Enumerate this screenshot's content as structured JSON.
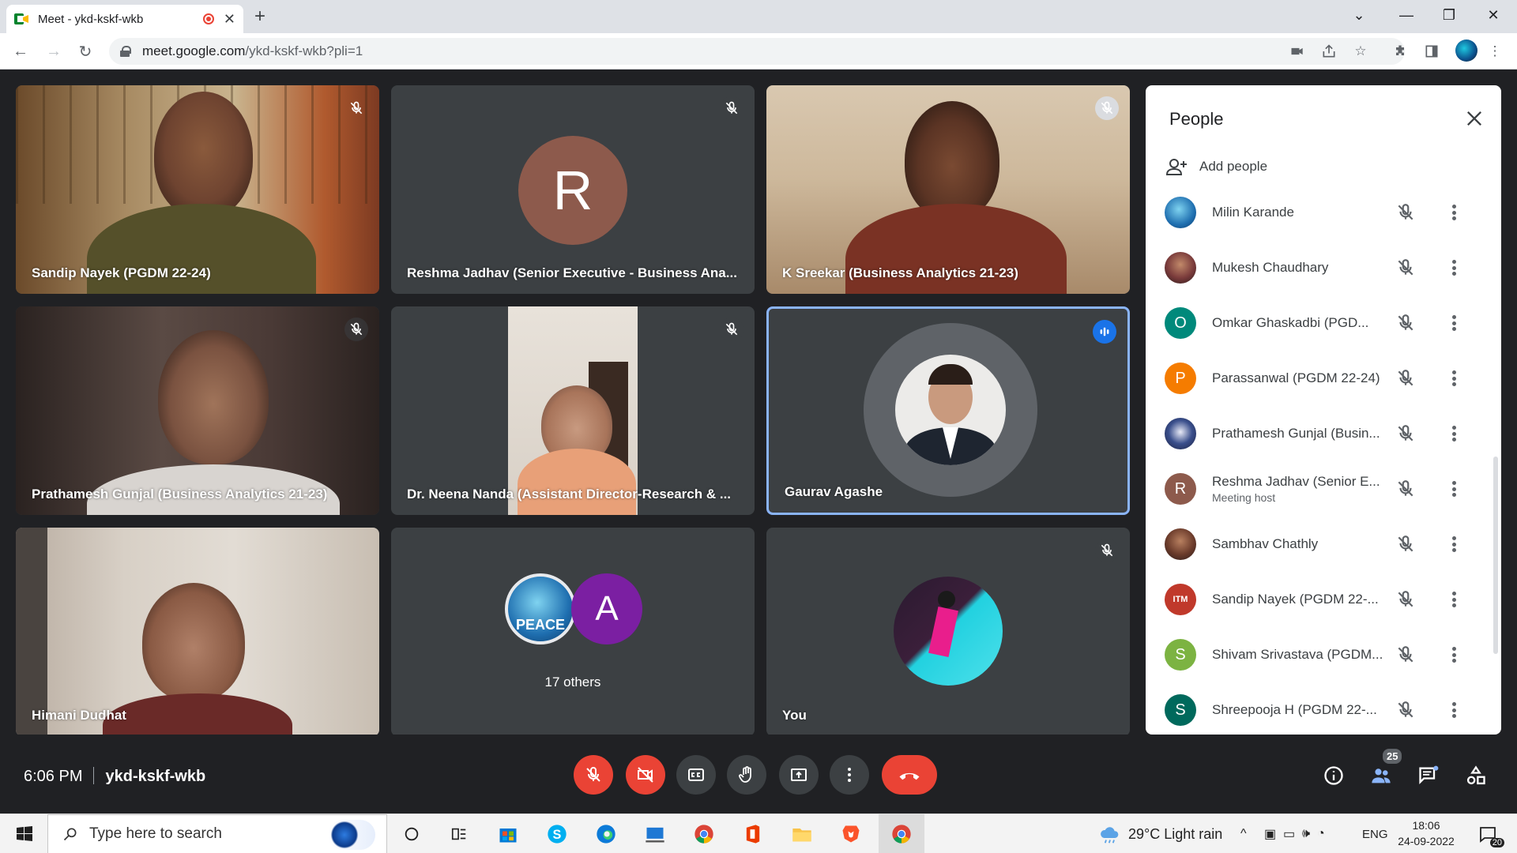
{
  "browser": {
    "tab_title": "Meet - ykd-kskf-wkb",
    "url_host": "meet.google.com",
    "url_path": "/ykd-kskf-wkb?pli=1"
  },
  "tiles": [
    {
      "name": "Sandip Nayek (PGDM 22-24)"
    },
    {
      "name": "Reshma Jadhav (Senior Executive - Business Ana...",
      "initial": "R",
      "color": "#8d5a4c"
    },
    {
      "name": "K Sreekar (Business Analytics 21-23)"
    },
    {
      "name": "Prathamesh Gunjal (Business Analytics 21-23)"
    },
    {
      "name": "Dr. Neena Nanda (Assistant Director-Research & ..."
    },
    {
      "name": "Gaurav Agashe"
    },
    {
      "name": "Himani Dudhat"
    },
    {
      "others_label": "17 others",
      "initial": "A",
      "color": "#7b1fa2",
      "logo_text": "PEACE"
    },
    {
      "name": "You"
    }
  ],
  "bottom_bar": {
    "time": "6:06 PM",
    "meeting_code": "ykd-kskf-wkb",
    "participant_count": "25"
  },
  "people_panel": {
    "title": "People",
    "add_people": "Add people",
    "participants": [
      {
        "name": "Milin Karande",
        "avatar": "peace-logo",
        "color": "#2a6fb0"
      },
      {
        "name": "Mukesh Chaudhary",
        "avatar": "photo",
        "color": "#7a3b3b"
      },
      {
        "name": "Omkar Ghaskadbi (PGD...",
        "initial": "O",
        "color": "#00897b"
      },
      {
        "name": "Parassanwal (PGDM 22-24)",
        "initial": "P",
        "color": "#f57c00"
      },
      {
        "name": "Prathamesh Gunjal (Busin...",
        "avatar": "photo",
        "color": "#3a4f8c"
      },
      {
        "name": "Reshma Jadhav (Senior E...",
        "sub": "Meeting host",
        "initial": "R",
        "color": "#8d5a4c"
      },
      {
        "name": "Sambhav Chathly",
        "avatar": "photo",
        "color": "#6b3b2b"
      },
      {
        "name": "Sandip Nayek (PGDM 22-...",
        "avatar": "itm-logo",
        "color": "#c0392b",
        "logo_text": "ITM"
      },
      {
        "name": "Shivam Srivastava (PGDM...",
        "initial": "S",
        "color": "#7cb342"
      },
      {
        "name": "Shreepooja H (PGDM 22-...",
        "initial": "S",
        "color": "#00695c"
      }
    ]
  },
  "taskbar": {
    "search_placeholder": "Type here to search",
    "weather": "29°C  Light rain",
    "language": "ENG",
    "time": "18:06",
    "date": "24-09-2022",
    "notification_count": "20"
  }
}
